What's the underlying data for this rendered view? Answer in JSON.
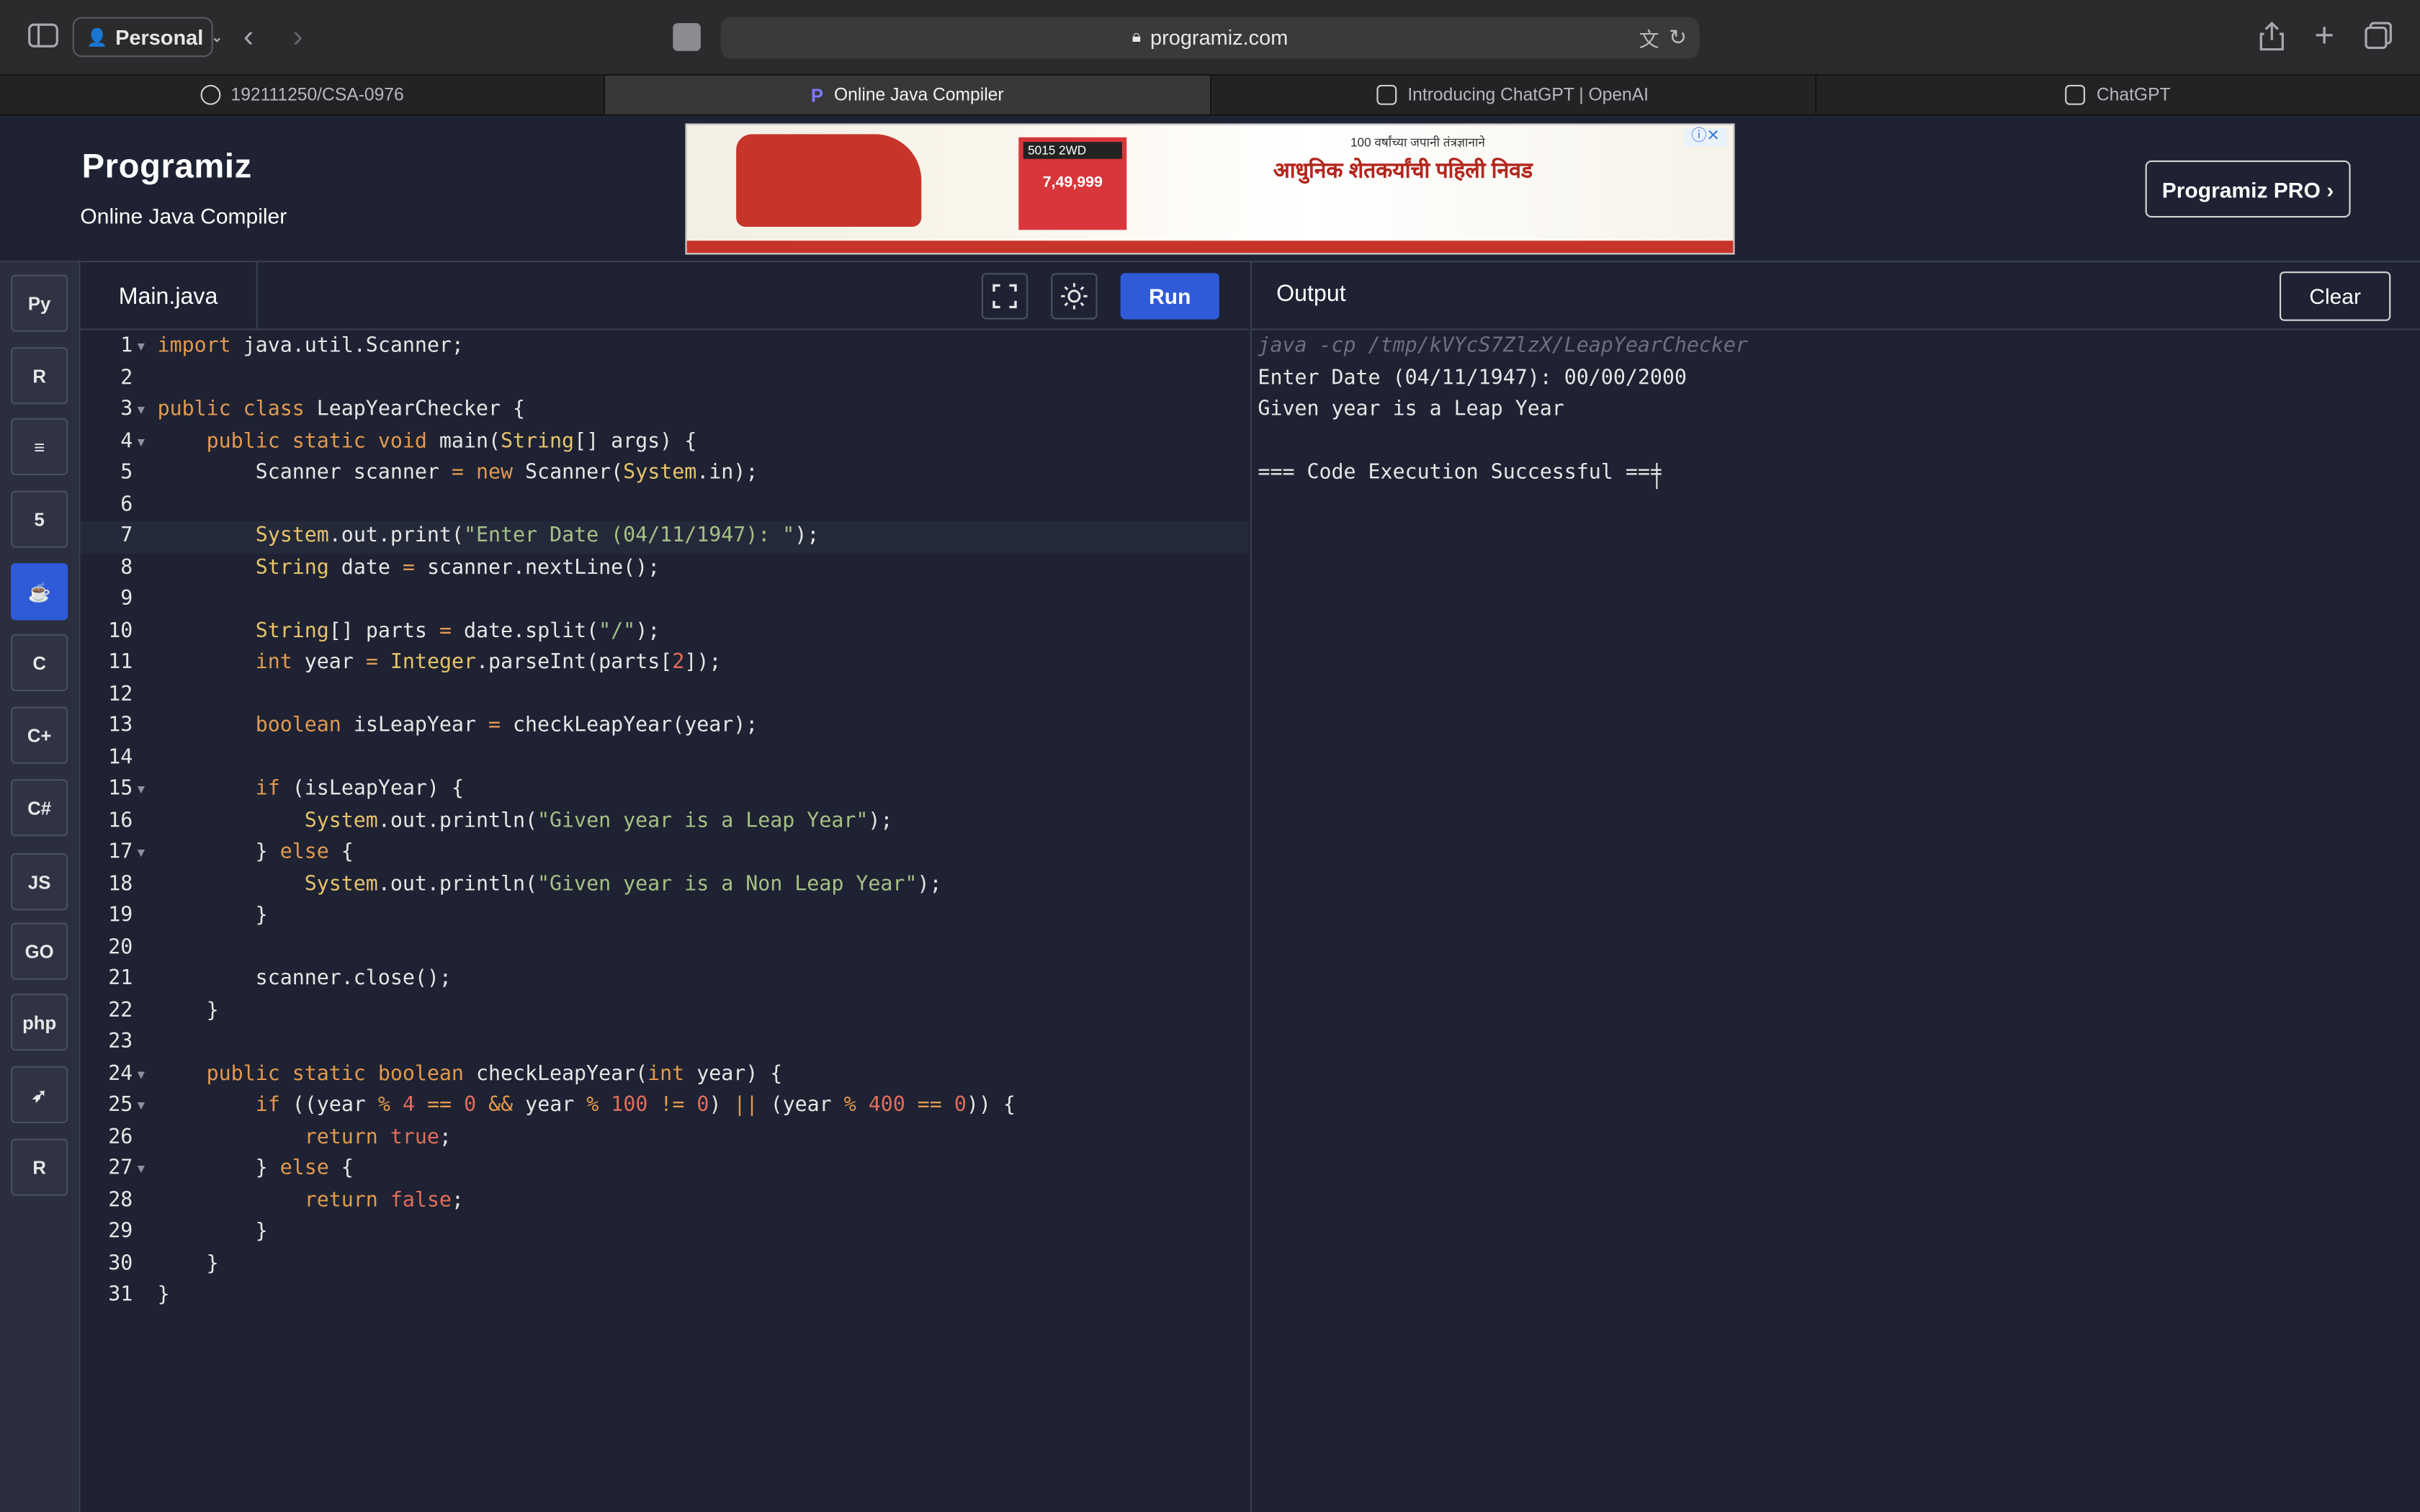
{
  "browser": {
    "profile": "Personal",
    "address": "programiz.com",
    "tabs": [
      {
        "label": "192111250/CSA-0976",
        "icon": "github-icon"
      },
      {
        "label": "Online Java Compiler",
        "icon": "programiz-icon"
      },
      {
        "label": "Introducing ChatGPT | OpenAI",
        "icon": "openai-icon"
      },
      {
        "label": "ChatGPT",
        "icon": "openai-icon"
      }
    ],
    "active_tab": 1
  },
  "header": {
    "logo": "Programiz",
    "subtitle": "Online Java Compiler",
    "pro_button": "Programiz PRO",
    "ad": {
      "headline": "आधुनिक शेतकर्यांची पहिली निवड",
      "tagline": "100 वर्षांच्या जपानी तंत्रज्ञानाने",
      "price": "7,49,999",
      "badge": "5015 2WD"
    }
  },
  "sidebar": {
    "languages": [
      {
        "name": "python-icon",
        "glyph": "Py"
      },
      {
        "name": "r-icon",
        "glyph": "R"
      },
      {
        "name": "sql-icon",
        "glyph": "≡"
      },
      {
        "name": "html-icon",
        "glyph": "5"
      },
      {
        "name": "java-icon",
        "glyph": "☕",
        "active": true
      },
      {
        "name": "c-icon",
        "glyph": "C"
      },
      {
        "name": "cpp-icon",
        "glyph": "C+"
      },
      {
        "name": "csharp-icon",
        "glyph": "C#"
      },
      {
        "name": "javascript-icon",
        "glyph": "JS"
      },
      {
        "name": "go-icon",
        "glyph": "GO"
      },
      {
        "name": "php-icon",
        "glyph": "php"
      },
      {
        "name": "swift-icon",
        "glyph": "➶"
      },
      {
        "name": "rust-icon",
        "glyph": "R"
      }
    ]
  },
  "editor": {
    "file_name": "Main.java",
    "run_label": "Run",
    "highlighted_line": 7,
    "lines": [
      [
        [
          "kw",
          "import"
        ],
        [
          "",
          "java.util.Scanner;"
        ]
      ],
      [],
      [
        [
          "kw",
          "public class"
        ],
        [
          "",
          "LeapYearChecker {"
        ]
      ],
      [
        [
          "",
          "    "
        ],
        [
          "kw",
          "public static void"
        ],
        [
          "",
          "main("
        ],
        [
          "cls",
          "String"
        ],
        [
          "",
          "[] args) {"
        ]
      ],
      [
        [
          "",
          "        Scanner scanner "
        ],
        [
          "kw",
          "="
        ],
        [
          "",
          ""
        ],
        [
          "kw",
          " new"
        ],
        [
          "",
          "Scanner("
        ],
        [
          "cls",
          "System"
        ],
        [
          "",
          ".in);"
        ]
      ],
      [],
      [
        [
          "",
          "        "
        ],
        [
          "cls",
          "System"
        ],
        [
          "",
          ".out.print("
        ],
        [
          "str",
          "\"Enter Date (04/11/1947): \""
        ],
        [
          "",
          ");"
        ]
      ],
      [
        [
          "",
          "        "
        ],
        [
          "cls",
          "String"
        ],
        [
          "",
          "date "
        ],
        [
          "kw",
          "="
        ],
        [
          "",
          "scanner.nextLine();"
        ]
      ],
      [],
      [
        [
          "",
          "        "
        ],
        [
          "cls",
          "String"
        ],
        [
          "",
          "[] parts "
        ],
        [
          "kw",
          "="
        ],
        [
          "",
          "date.split("
        ],
        [
          "str",
          "\"/\""
        ],
        [
          "",
          ");"
        ]
      ],
      [
        [
          "",
          "        "
        ],
        [
          "kw",
          "int"
        ],
        [
          "",
          "year "
        ],
        [
          "kw",
          "="
        ],
        [
          "",
          ""
        ],
        [
          "cls",
          " Integer"
        ],
        [
          "",
          ".parseInt(parts["
        ],
        [
          "num",
          "2"
        ],
        [
          "",
          "]);"
        ]
      ],
      [],
      [
        [
          "",
          "        "
        ],
        [
          "kw",
          "boolean"
        ],
        [
          "",
          "isLeapYear "
        ],
        [
          "kw",
          "="
        ],
        [
          "",
          "checkLeapYear(year);"
        ]
      ],
      [],
      [
        [
          "",
          "        "
        ],
        [
          "kw",
          "if"
        ],
        [
          "",
          "(isLeapYear) {"
        ]
      ],
      [
        [
          "",
          "            "
        ],
        [
          "cls",
          "System"
        ],
        [
          "",
          ".out.println("
        ],
        [
          "str",
          "\"Given year is a Leap Year\""
        ],
        [
          "",
          ");"
        ]
      ],
      [
        [
          "",
          "        } "
        ],
        [
          "kw",
          "else"
        ],
        [
          "",
          "{"
        ]
      ],
      [
        [
          "",
          "            "
        ],
        [
          "cls",
          "System"
        ],
        [
          "",
          ".out.println("
        ],
        [
          "str",
          "\"Given year is a Non Leap Year\""
        ],
        [
          "",
          ");"
        ]
      ],
      [
        [
          "",
          "        }"
        ]
      ],
      [],
      [
        [
          "",
          "        scanner.close();"
        ]
      ],
      [
        [
          "",
          "    }"
        ]
      ],
      [],
      [
        [
          "",
          "    "
        ],
        [
          "kw",
          "public static boolean"
        ],
        [
          "",
          "checkLeapYear("
        ],
        [
          "kw",
          "int"
        ],
        [
          "",
          "year) {"
        ]
      ],
      [
        [
          "",
          "        "
        ],
        [
          "kw",
          "if"
        ],
        [
          "",
          "((year "
        ],
        [
          "kw",
          "%"
        ],
        [
          "",
          ""
        ],
        [
          "num",
          " 4"
        ],
        [
          "",
          ""
        ],
        [
          "kw",
          " =="
        ],
        [
          "",
          ""
        ],
        [
          "num",
          " 0"
        ],
        [
          "",
          ""
        ],
        [
          "kw",
          " &&"
        ],
        [
          "",
          "year "
        ],
        [
          "kw",
          "%"
        ],
        [
          "",
          ""
        ],
        [
          "num",
          " 100"
        ],
        [
          "",
          ""
        ],
        [
          "kw",
          " !="
        ],
        [
          "",
          ""
        ],
        [
          "num",
          " 0"
        ],
        [
          "",
          ") "
        ],
        [
          "kw",
          "||"
        ],
        [
          "",
          "(year "
        ],
        [
          "kw",
          "%"
        ],
        [
          "",
          ""
        ],
        [
          "num",
          " 400"
        ],
        [
          "",
          ""
        ],
        [
          "kw",
          " =="
        ],
        [
          "",
          ""
        ],
        [
          "num",
          " 0"
        ],
        [
          "",
          ")) {"
        ]
      ],
      [
        [
          "",
          "            "
        ],
        [
          "kw",
          "return"
        ],
        [
          "",
          ""
        ],
        [
          "num",
          " true"
        ],
        [
          "",
          ";"
        ]
      ],
      [
        [
          "",
          "        } "
        ],
        [
          "kw",
          "else"
        ],
        [
          "",
          "{"
        ]
      ],
      [
        [
          "",
          "            "
        ],
        [
          "kw",
          "return"
        ],
        [
          "",
          ""
        ],
        [
          "num",
          " false"
        ],
        [
          "",
          ";"
        ]
      ],
      [
        [
          "",
          "        }"
        ]
      ],
      [
        [
          "",
          "    }"
        ]
      ],
      [
        [
          "",
          "}"
        ]
      ]
    ],
    "foldable": [
      1,
      3,
      4,
      15,
      17,
      24,
      25,
      27
    ]
  },
  "output": {
    "title": "Output",
    "clear_label": "Clear",
    "lines": [
      {
        "text": "java -cp /tmp/kVYcS7ZlzX/LeapYearChecker",
        "cmd": true
      },
      {
        "text": "Enter Date (04/11/1947): 00/00/2000"
      },
      {
        "text": "Given year is a Leap Year"
      },
      {
        "text": ""
      },
      {
        "text": "=== Code Execution Successful ==="
      }
    ]
  }
}
